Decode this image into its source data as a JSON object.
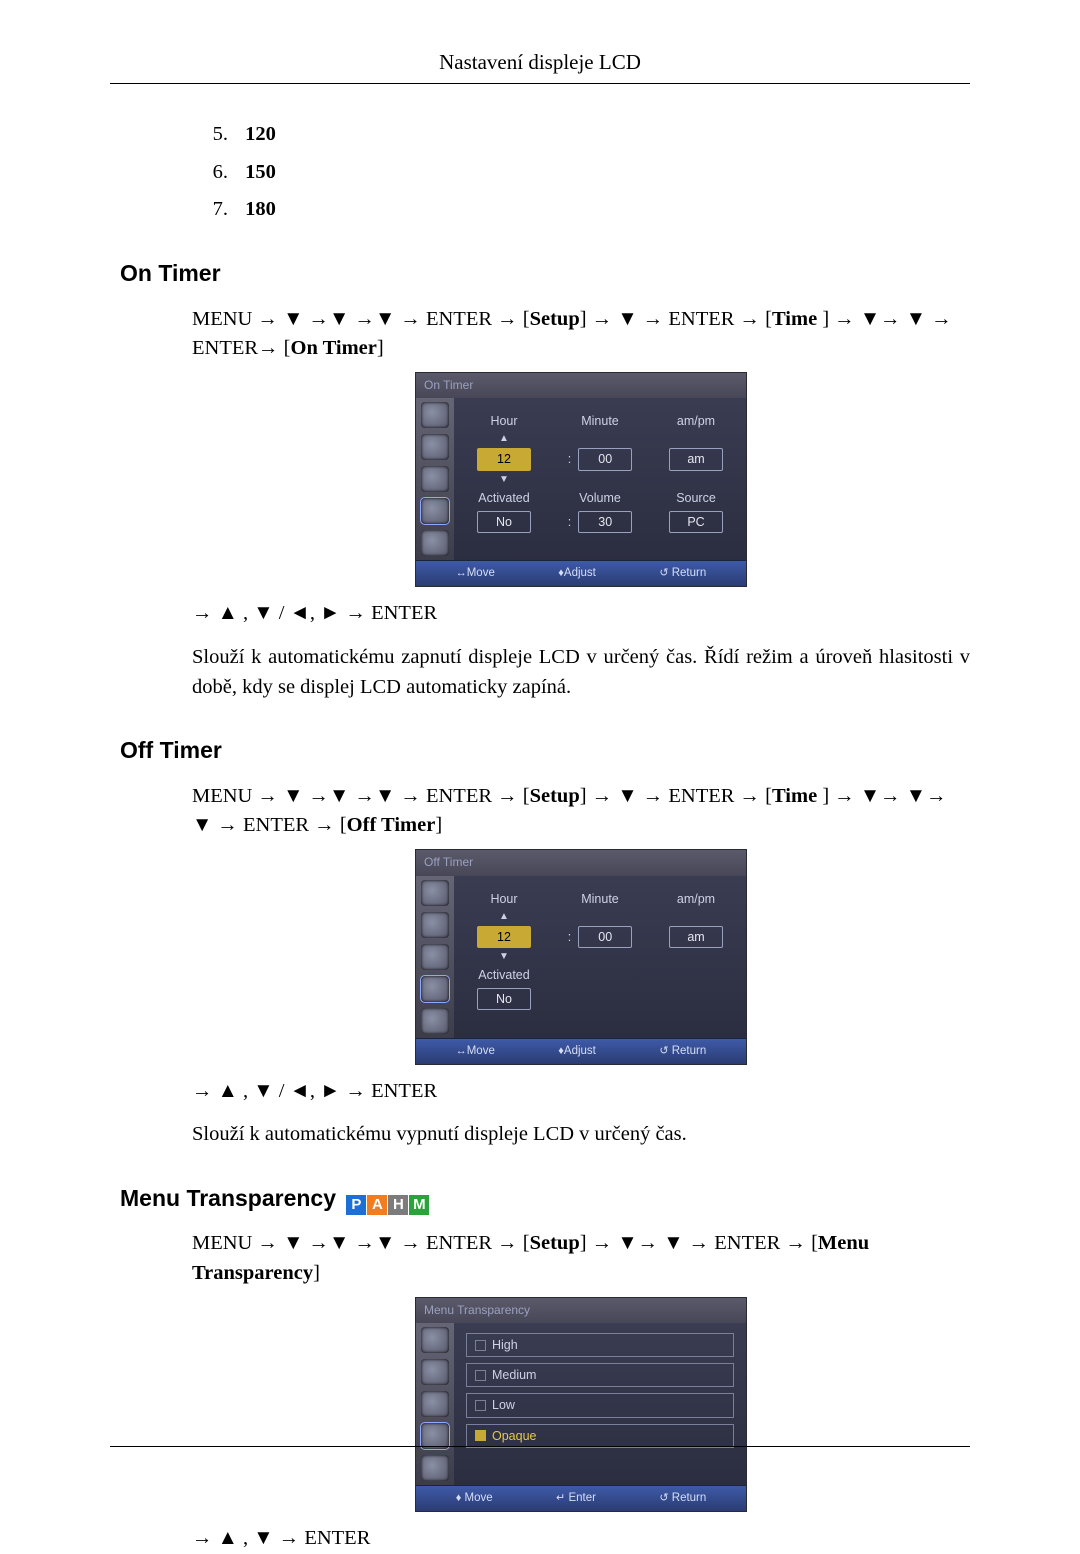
{
  "page": {
    "header": "Nastavení displeje LCD"
  },
  "list": {
    "i5": {
      "n": "5.",
      "v": "120"
    },
    "i6": {
      "n": "6.",
      "v": "150"
    },
    "i7": {
      "n": "7.",
      "v": "180"
    }
  },
  "onTimer": {
    "heading": "On Timer",
    "nav1a": "MENU → ▼ →▼ →▼ → ENTER → [",
    "nav1b": "Setup",
    "nav1c": "] → ▼ → ENTER → [",
    "nav1d": "Time",
    "nav1e": " ] → ▼→ ▼ → ENTER→ [",
    "nav1f": "On Timer",
    "nav1g": "]",
    "nav2": "→ ▲ , ▼ / ◄, ► → ENTER",
    "desc": "Slouží k automatickému zapnutí displeje LCD v určený čas. Řídí režim a úroveň hlasitosti v době, kdy se displej LCD automaticky zapíná."
  },
  "offTimer": {
    "heading": "Off Timer",
    "nav1a": "MENU → ▼ →▼ →▼ → ENTER → [",
    "nav1b": "Setup",
    "nav1c": "] → ▼ → ENTER → [",
    "nav1d": "Time",
    "nav1e": " ] → ▼→ ▼→ ▼ → ENTER → [",
    "nav1f": "Off Timer",
    "nav1g": "]",
    "nav2": "→ ▲ , ▼ / ◄, ► → ENTER",
    "desc": "Slouží k automatickému vypnutí displeje LCD v určený čas."
  },
  "menuTrans": {
    "heading": "Menu Transparency",
    "nav1a": "MENU → ▼ →▼ →▼ → ENTER → [",
    "nav1b": "Setup",
    "nav1c": "] → ▼→ ▼ → ENTER → [",
    "nav1d": "Menu Transparency",
    "nav1e": "]",
    "nav2": "→ ▲ , ▼ → ENTER"
  },
  "osd": {
    "onTitle": "On Timer",
    "offTitle": "Off Timer",
    "mtTitle": "Menu Transparency",
    "labels": {
      "hour": "Hour",
      "minute": "Minute",
      "ampm": "am/pm",
      "activated": "Activated",
      "volume": "Volume",
      "source": "Source"
    },
    "vals": {
      "hour": "12",
      "minute": "00",
      "ampm": "am",
      "activated": "No",
      "volume": "30",
      "source": "PC"
    },
    "transOptions": {
      "high": "High",
      "medium": "Medium",
      "low": "Low",
      "opaque": "Opaque"
    },
    "footer": {
      "moveA": "Move",
      "adjust": "Adjust",
      "return": "Return",
      "moveB": "Move",
      "enter": "Enter"
    },
    "glyph": {
      "lr": "↔",
      "ud": "♦",
      "ret": "↺",
      "ent": "↵"
    }
  },
  "badges": {
    "p": "P",
    "a": "A",
    "h": "H",
    "m": "M"
  }
}
